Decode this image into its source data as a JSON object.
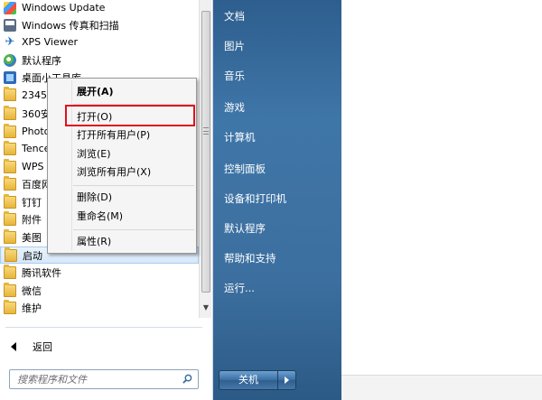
{
  "programs": [
    {
      "label": "Windows Update",
      "icon": "windows-update-icon"
    },
    {
      "label": "Windows 传真和扫描",
      "icon": "fax-scan-icon"
    },
    {
      "label": "XPS Viewer",
      "icon": "xps-viewer-icon"
    },
    {
      "label": "默认程序",
      "icon": "default-programs-icon"
    },
    {
      "label": "桌面小工具库",
      "icon": "desktop-gadgets-icon"
    },
    {
      "label": "2345王牌软件",
      "icon": "folder-icon"
    },
    {
      "label": "360安全中心",
      "icon": "folder-icon"
    },
    {
      "label": "Photoshop",
      "icon": "folder-icon"
    },
    {
      "label": "Tencent",
      "icon": "folder-icon"
    },
    {
      "label": "WPS Office",
      "icon": "folder-icon"
    },
    {
      "label": "百度网盘",
      "icon": "folder-icon"
    },
    {
      "label": "钉钉",
      "icon": "folder-icon"
    },
    {
      "label": "附件",
      "icon": "folder-icon"
    },
    {
      "label": "美图",
      "icon": "folder-icon"
    },
    {
      "label": "启动",
      "icon": "folder-icon"
    },
    {
      "label": "腾讯软件",
      "icon": "folder-icon"
    },
    {
      "label": "微信",
      "icon": "folder-icon"
    },
    {
      "label": "维护",
      "icon": "folder-icon"
    }
  ],
  "back_label": "返回",
  "search": {
    "placeholder": "搜索程序和文件"
  },
  "right_items": [
    "文档",
    "图片",
    "音乐",
    "游戏",
    "计算机",
    "控制面板",
    "设备和打印机",
    "默认程序",
    "帮助和支持",
    "运行..."
  ],
  "shutdown_label": "关机",
  "context_menu": {
    "expand": "展开(A)",
    "open": "打开(O)",
    "open_all_users": "打开所有用户(P)",
    "browse": "浏览(E)",
    "browse_all_users": "浏览所有用户(X)",
    "delete": "删除(D)",
    "rename": "重命名(M)",
    "properties": "属性(R)"
  },
  "colors": {
    "highlight_box": "#e0111b",
    "right_pane": "#3c6f9f"
  }
}
